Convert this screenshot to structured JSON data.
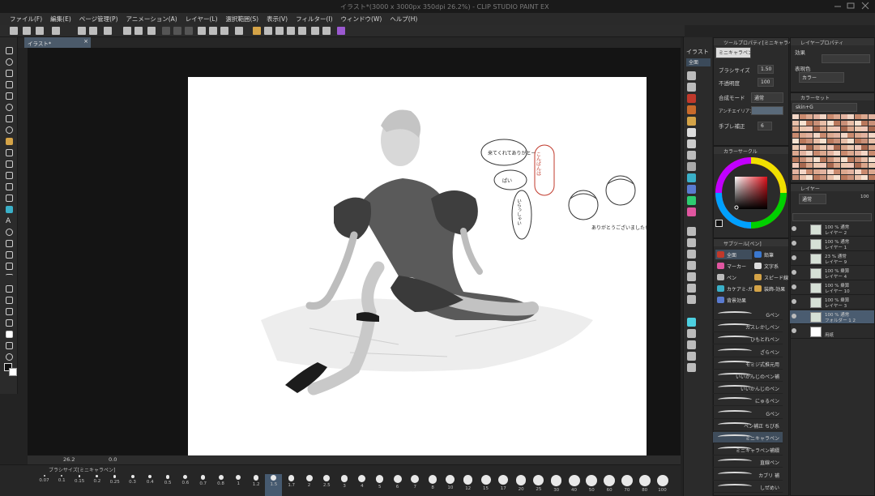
{
  "window": {
    "title": "イラスト*(3000 x 3000px 350dpi 26.2%) - CLIP STUDIO PAINT EX"
  },
  "menu": [
    "ファイル(F)",
    "編集(E)",
    "ページ管理(P)",
    "アニメーション(A)",
    "レイヤー(L)",
    "選択範囲(S)",
    "表示(V)",
    "フィルター(I)",
    "ウィンドウ(W)",
    "ヘルプ(H)"
  ],
  "document_tab": {
    "label": "イラスト*",
    "close": "×"
  },
  "status": {
    "zoom": "26.2",
    "angle": "0.0"
  },
  "brush_size_panel": {
    "title": "ブラシサイズ[ミニキャラペン]",
    "sizes": [
      "0.07",
      "0.1",
      "0.15",
      "0.2",
      "0.25",
      "0.3",
      "0.4",
      "0.5",
      "0.6",
      "0.7",
      "0.8",
      "1",
      "1.2",
      "1.5",
      "1.7",
      "2",
      "2.5",
      "3",
      "4",
      "5",
      "6",
      "7",
      "8",
      "10",
      "12",
      "15",
      "17",
      "20",
      "25",
      "30",
      "40",
      "50",
      "60",
      "70",
      "80",
      "100"
    ],
    "selected": "1.5"
  },
  "navigator": {
    "header": "イラスト",
    "tab": "全面"
  },
  "tool_property": {
    "title": "ツールプロパティ[ミニキャラペン]",
    "preset": "ミニキャラペン",
    "brush_size_label": "ブラシサイズ",
    "brush_size_value": "1.50",
    "opacity_label": "不透明度",
    "opacity_value": "100",
    "blend_label": "合成モード",
    "blend_value": "通常",
    "aa_label": "アンチエイリアス",
    "stabilization_label": "手ブレ補正",
    "stabilization_value": "6"
  },
  "layer_property": {
    "title": "レイヤープロパティ",
    "effect_label": "効果",
    "expression_label": "表現色",
    "expression_value": "カラー"
  },
  "color_set": {
    "title": "カラーセット",
    "set_name": "skin+G"
  },
  "color_circle": {
    "title": "カラーサークル"
  },
  "sub_tool": {
    "title": "サブツール[ペン]",
    "categories": [
      "鉛筆",
      "マーカー",
      "文字系",
      "ペン",
      "スピード線",
      "カケアミ-ガ",
      "装飾-効果",
      "背景効果"
    ],
    "brushes": [
      "Gペン",
      "カスレかしペン",
      "ひもとれペン",
      "ざらペン",
      "モミジ式推元用",
      "いいかんじのペン補",
      "いいかんじのペン",
      "にゅるペン",
      "Gペン",
      "ペン補正 ちび系",
      "ミニキャラペン",
      "ミニキャラペン補綴",
      "直線ペン",
      "カブリ 補",
      "しぜめい"
    ],
    "selected_brush": "ミニキャラペン"
  },
  "layers": {
    "title": "レイヤー",
    "blend": "通常",
    "opacity": "100",
    "items": [
      {
        "mode": "100 % 通常",
        "name": "レイヤー 2"
      },
      {
        "mode": "100 % 通常",
        "name": "レイヤー 1"
      },
      {
        "mode": "23 % 通常",
        "name": "レイヤー 9"
      },
      {
        "mode": "100 % 乗算",
        "name": "レイヤー 4"
      },
      {
        "mode": "100 % 乗算",
        "name": "レイヤー 10"
      },
      {
        "mode": "100 % 乗算",
        "name": "レイヤー 3"
      },
      {
        "mode": "100 % 通常",
        "name": "フォルダー 1 2"
      },
      {
        "mode": "",
        "name": "用紙"
      }
    ],
    "selected_index": 6
  },
  "artwork": {
    "bubble_thanks": "来てくれてありがとー",
    "bubble_hello": "こんばんは",
    "bubble_chibi": "ありがとうございました!!",
    "bubble_small_1": "ぱい",
    "bubble_small_2": "いらっしゃい"
  },
  "colors": {
    "accent": "#4a5c70",
    "background": "#141414",
    "panel": "#2b2b2b"
  }
}
